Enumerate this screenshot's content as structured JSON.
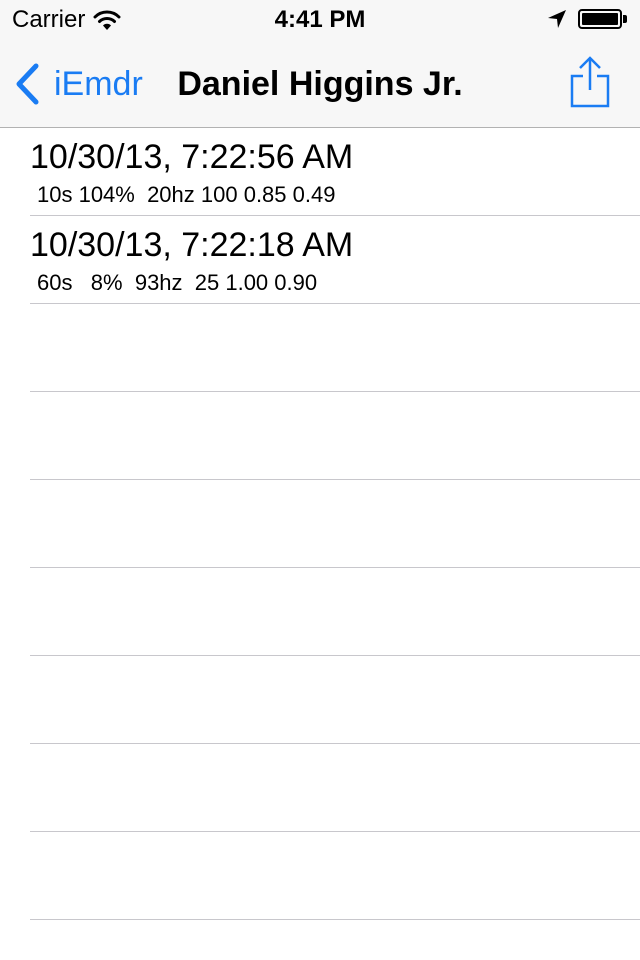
{
  "status_bar": {
    "carrier": "Carrier",
    "time": "4:41 PM"
  },
  "nav": {
    "back_label": "iEmdr",
    "title": "Daniel Higgins Jr.",
    "accent_color": "#1a7cf3"
  },
  "sessions": [
    {
      "title": "10/30/13, 7:22:56 AM",
      "detail": "10s 104%  20hz 100 0.85 0.49"
    },
    {
      "title": "10/30/13, 7:22:18 AM",
      "detail": "60s   8%  93hz  25 1.00 0.90"
    },
    {
      "title": "",
      "detail": ""
    },
    {
      "title": "",
      "detail": ""
    },
    {
      "title": "",
      "detail": ""
    },
    {
      "title": "",
      "detail": ""
    },
    {
      "title": "",
      "detail": ""
    },
    {
      "title": "",
      "detail": ""
    },
    {
      "title": "",
      "detail": ""
    }
  ],
  "icons": {
    "wifi": "wifi-icon",
    "location": "location-arrow-icon",
    "battery": "battery-icon",
    "back": "chevron-left-icon",
    "share": "share-icon"
  }
}
